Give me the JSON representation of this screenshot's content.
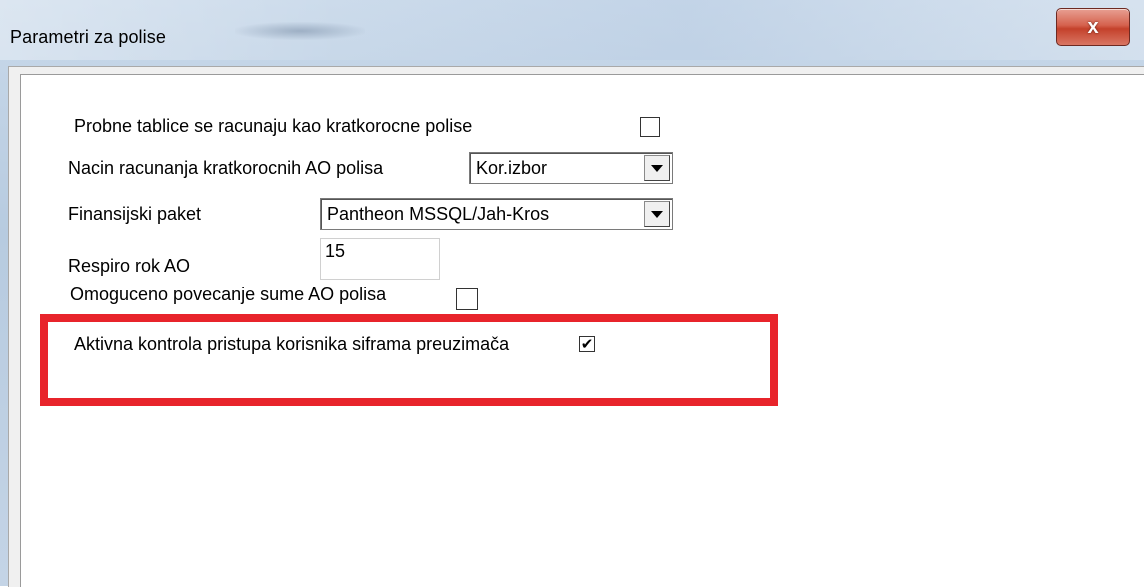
{
  "window": {
    "title": "Parametri za polise",
    "close_label": "x"
  },
  "form": {
    "probne_tablice": {
      "label": "Probne tablice se racunaju kao kratkorocne polise",
      "checked": false
    },
    "nacin_racunanja": {
      "label": "Nacin racunanja kratkorocnih AO polisa",
      "value": "Kor.izbor"
    },
    "finansijski_paket": {
      "label": "Finansijski paket",
      "value": "Pantheon MSSQL/Jah-Kros"
    },
    "respiro_rok": {
      "label": "Respiro rok AO",
      "value": "15"
    },
    "povecanje_sume": {
      "label": "Omoguceno povecanje sume AO polisa",
      "checked": false
    },
    "aktivna_kontrola": {
      "label": "Aktivna kontrola pristupa korisnika siframa preuzimača",
      "checked": true
    }
  },
  "icons": {
    "check_glyph": "✔",
    "close_icon": "close-icon",
    "dropdown_icon": "chevron-down-icon"
  },
  "colors": {
    "highlight": "#e8242b",
    "close_button": "#c4412b"
  }
}
